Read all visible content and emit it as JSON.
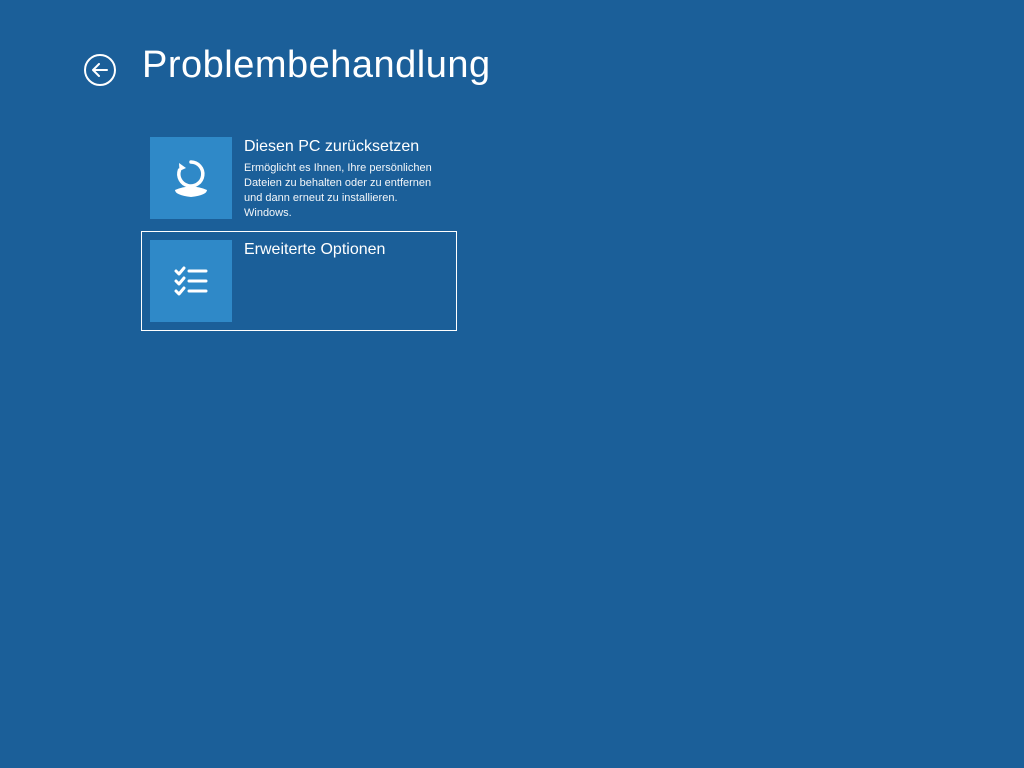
{
  "header": {
    "title": "Problembehandlung"
  },
  "options": [
    {
      "title": "Diesen PC zurücksetzen",
      "desc": "Ermöglicht es Ihnen, Ihre persönlichen Dateien zu behalten oder zu entfernen und dann erneut zu installieren. Windows.",
      "icon": "reset-pc-icon",
      "selected": false
    },
    {
      "title": "Erweiterte Optionen",
      "desc": "",
      "icon": "advanced-options-icon",
      "selected": true
    }
  ],
  "colors": {
    "background": "#1b5f99",
    "tile": "#2f89c8",
    "text": "#ffffff"
  }
}
